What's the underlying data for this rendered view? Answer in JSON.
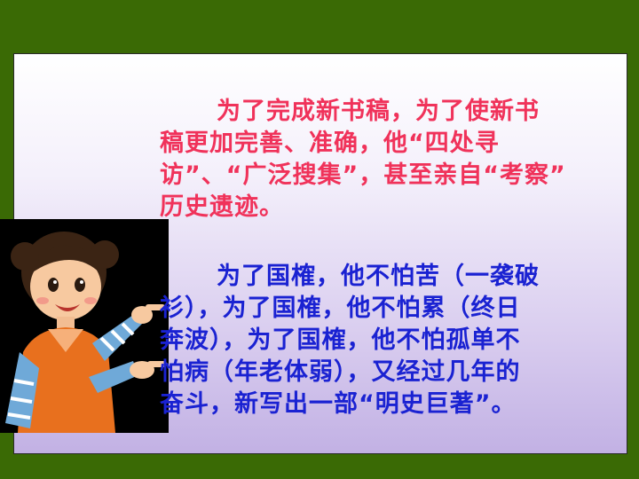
{
  "slide": {
    "paragraph1": [
      "为了完成新书稿，为了使新书",
      "稿更加完善、准确，他“四处寻",
      "访”、“广泛搜集”，甚至亲自“考察”",
      "历史遗迹。"
    ],
    "paragraph2": [
      "为了国榷，他不怕苦（一袭破",
      "衫），为了国榷，他不怕累（终日",
      "奔波），为了国榷，他不怕孤单不",
      "怕病（年老体弱），又经过几年的",
      "奋斗，新写出一部“明史巨著”。"
    ]
  },
  "colors": {
    "background": "#3a6a05",
    "paragraph1": "#f0325a",
    "paragraph2": "#1a22d2"
  }
}
